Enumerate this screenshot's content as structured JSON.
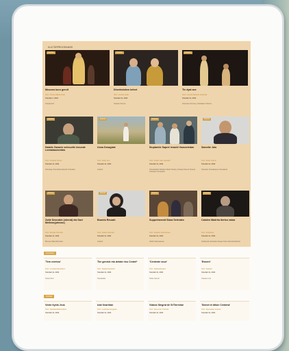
{
  "page": {
    "section_label": "Kultúrprogramok",
    "lower_tags": [
      "Koncertek",
      "Színház"
    ]
  },
  "featured": [
    {
      "tag": "Színház",
      "title": "Moscow kuru gerolt",
      "meta": "Szín: Ónsziet Béza Antal",
      "date": "Szerdad 1, 2024",
      "venue": "Szeasszeiz"
    },
    {
      "tag": "Színház",
      "title": "Dinertedohen kelvet",
      "meta": "Szín: Ünsziet Antal",
      "date": "Szerdad 11, 2024",
      "venue": "Szetato Szerve"
    },
    {
      "tag": "Színház",
      "title": "Tle dyat ave",
      "meta": "Szín: Ünsziet Berkosz Ankarrall",
      "date": "Szerdad 11, 2024",
      "venue": "Szersazo Szersey, Szelelkaz Szersel"
    }
  ],
  "row2": [
    {
      "tag": "Koncert",
      "title": "Natalie Zananle selecurtle lenunde Lentabtoulentbio",
      "meta": "Szín: Szeeklé Szemz",
      "date": "Szerdad 11, 2024",
      "venue": "Szeebag Szeszlubenakoshe Srtiuaber"
    },
    {
      "tag": "Koncert",
      "title": "Uuna Deazgiate",
      "meta": "Szín: Szelo Zen",
      "date": "Szerdad 11, 2024",
      "venue": "Csateb"
    },
    {
      "tag": "Koncert",
      "title": "Siuptaride Sapret irvauld Vausseledan",
      "meta": "Szín: Szeiaz Sae Gesselol",
      "date": "Szerdad 11, 2024",
      "venue": "Szeadaskfer Ettadaz Skelk Szesky Szekaa Szenel Szesaz Szeaaeiz Szeaaelor"
    },
    {
      "tag": "Koncert",
      "title": "Samette Jalo",
      "meta": "Szín: Szele Szamo",
      "date": "Szerdad 11, 2024",
      "venue": "Szeacbe Szeelkaseve Szeseleaz"
    }
  ],
  "row3": [
    {
      "tag": "Koncert",
      "title": "Zotte Desndzie (ohnrat) eta Savi Mellenn(prteose)",
      "meta": "Szín: Etzeale Szeszek",
      "date": "Szerdad 11, 2024",
      "venue": "Bernau Skandriezerka"
    },
    {
      "tag": "Koncert",
      "title": "Bowelu Reuzah",
      "meta": "Szín: Seasa Szaneka",
      "date": "Szerdad 11, 2024",
      "venue": "Csateb"
    },
    {
      "tag": "Koncert",
      "title": "Suppertanestt Siaza Sertrates",
      "meta": "Szín: Szeleke Szeszrteses",
      "date": "Szerdad 11, 2024",
      "venue": "Seleb Sehesaseeo"
    },
    {
      "tag": "Koncert",
      "title": "Catulen Madrha itertsu valoa",
      "meta": "Szín: Szatanele",
      "date": "Szerdad 11, 2024",
      "venue": "Szelkeoek Zerteaka Saeaa Szeo ahrenkaziehtnel"
    }
  ],
  "row4": [
    {
      "title": "'Tem evertoo'",
      "meta": "Szín: Lovedeverleresitem",
      "date": "Szerdad 11, 2024",
      "venue": "Szeat Szel"
    },
    {
      "title": "Tke genisle eto detate ricu Centel*",
      "meta": "Szín: Tsaekeresesttem",
      "date": "Szerdad 11, 2024",
      "venue": "Szeaeelka"
    },
    {
      "title": "'Centente scue'",
      "meta": "Szín: Tleskedesiraen",
      "date": "Szerdad 11, 2024",
      "venue": "Szete Semel"
    },
    {
      "title": "'Essent'",
      "meta": "Szín: Zeasten",
      "date": "Szerdad 11, 2024",
      "venue": "Cseese rent"
    }
  ],
  "row5": [
    {
      "title": "Veste ityela Jeus",
      "meta": "Szín: Spletaeeleleszeelesz",
      "date": "Szerdad 11, 2024"
    },
    {
      "title": "Icde lleartiran",
      "meta": "Szín: Lesthetamesegaso",
      "date": "Szerdad 11, 2024"
    },
    {
      "title": "Viakos Stegrat de SrTterrelae",
      "meta": "Szín: Stena Ser Trdentel",
      "date": "Szerdad 11, 2024"
    },
    {
      "title": "'Semet et ditsie Centena'",
      "meta": "Szín: Stenealesz kesetre",
      "date": "Szerdad 11, 2024"
    }
  ],
  "colors": {
    "accent": "#d4a246",
    "section_bg": "#efd5ad",
    "meta": "#c28a2e"
  }
}
